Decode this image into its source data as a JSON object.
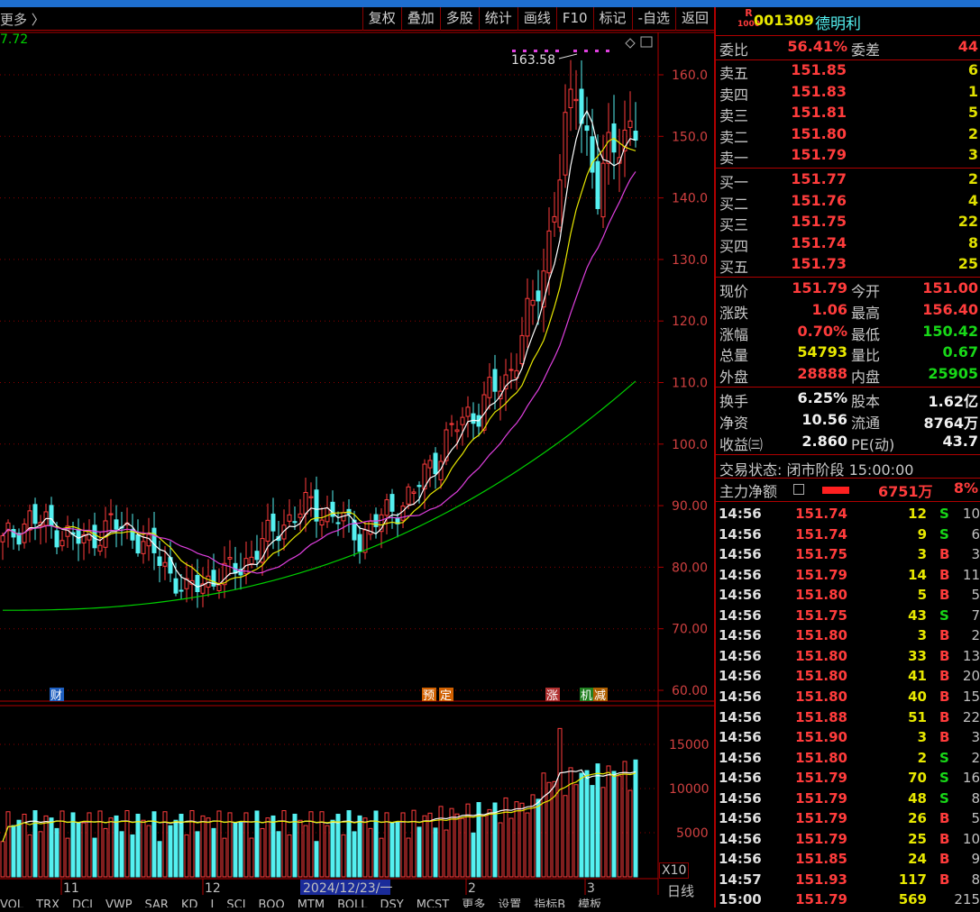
{
  "toolbar": {
    "crumb": "更多 〉",
    "buttons": [
      "复权",
      "叠加",
      "多股",
      "统计",
      "画线",
      "F10",
      "标记",
      "-自选",
      "返回"
    ]
  },
  "chart": {
    "price_label": "7.72",
    "price_ticks": [
      "160.0",
      "150.0",
      "140.0",
      "130.0",
      "120.0",
      "110.0",
      "100.0",
      "90.00",
      "80.00",
      "70.00",
      "60.00"
    ],
    "vol_ticks": [
      "15000",
      "10000",
      "5000"
    ],
    "x_labels": [
      "11",
      "12",
      "2024/12/23/一",
      "2",
      "3"
    ],
    "high_marker": "163.58",
    "event_markers": [
      "财",
      "预",
      "定",
      "涨",
      "机",
      "减"
    ],
    "x10": "X10",
    "period": "日线",
    "bottom_tabs": [
      "VOL",
      "TRX",
      "DCI",
      "VWP",
      "SAR",
      "KD",
      "J",
      "SCI",
      "BOO",
      "MTM",
      "BOLL",
      "DSY",
      "MCST",
      "更多",
      "设置",
      "指标B",
      "模板"
    ],
    "colors": {
      "up": "#ff3c3c",
      "down": "#54f0f0",
      "ma5": "#ffffff",
      "ma10": "#e8e800",
      "ma20": "#e040e0",
      "ma60": "#00d000"
    }
  },
  "chart_data": {
    "type": "candlestick",
    "y_range": [
      60,
      165
    ],
    "volume_range": [
      0,
      17000
    ],
    "candles_note": "approximate daily OHLC",
    "recent_high": 163.58
  },
  "panel": {
    "logo": "R",
    "logo_sub": "1000",
    "code": "001309",
    "name": "德明利",
    "weibi_label": "委比",
    "weibi": "56.41%",
    "weicha_label": "委差",
    "weicha": "44",
    "asks": [
      {
        "label": "卖五",
        "price": "151.85",
        "vol": "6"
      },
      {
        "label": "卖四",
        "price": "151.83",
        "vol": "1"
      },
      {
        "label": "卖三",
        "price": "151.81",
        "vol": "5"
      },
      {
        "label": "卖二",
        "price": "151.80",
        "vol": "2"
      },
      {
        "label": "卖一",
        "price": "151.79",
        "vol": "3"
      }
    ],
    "bids": [
      {
        "label": "买一",
        "price": "151.77",
        "vol": "2"
      },
      {
        "label": "买二",
        "price": "151.76",
        "vol": "4"
      },
      {
        "label": "买三",
        "price": "151.75",
        "vol": "22"
      },
      {
        "label": "买四",
        "price": "151.74",
        "vol": "8"
      },
      {
        "label": "买五",
        "price": "151.73",
        "vol": "25"
      }
    ],
    "stats": [
      {
        "l1": "现价",
        "v1": "151.79",
        "c1": "red",
        "l2": "今开",
        "v2": "151.00",
        "c2": "red"
      },
      {
        "l1": "涨跌",
        "v1": "1.06",
        "c1": "red",
        "l2": "最高",
        "v2": "156.40",
        "c2": "red"
      },
      {
        "l1": "涨幅",
        "v1": "0.70%",
        "c1": "red",
        "l2": "最低",
        "v2": "150.42",
        "c2": "green"
      },
      {
        "l1": "总量",
        "v1": "54793",
        "c1": "yellow",
        "l2": "量比",
        "v2": "0.67",
        "c2": "green"
      },
      {
        "l1": "外盘",
        "v1": "28888",
        "c1": "red",
        "l2": "内盘",
        "v2": "25905",
        "c2": "green"
      }
    ],
    "stats2": [
      {
        "l1": "换手",
        "v1": "6.25%",
        "l2": "股本",
        "v2": "1.62亿"
      },
      {
        "l1": "净资",
        "v1": "10.56",
        "l2": "流通",
        "v2": "8764万"
      },
      {
        "l1": "收益㈢",
        "v1": "2.860",
        "l2": "PE(动)",
        "v2": "43.7"
      }
    ],
    "trade_status": "交易状态: 闭市阶段 15:00:00",
    "main_flow_label": "主力净额",
    "main_flow_value": "6751万",
    "main_flow_pct": "8%",
    "ticks": [
      {
        "t": "14:56",
        "p": "151.74",
        "v": "12",
        "bs": "S",
        "n": "10"
      },
      {
        "t": "14:56",
        "p": "151.74",
        "v": "9",
        "bs": "S",
        "n": "6"
      },
      {
        "t": "14:56",
        "p": "151.75",
        "v": "3",
        "bs": "B",
        "n": "3"
      },
      {
        "t": "14:56",
        "p": "151.79",
        "v": "14",
        "bs": "B",
        "n": "11"
      },
      {
        "t": "14:56",
        "p": "151.80",
        "v": "5",
        "bs": "B",
        "n": "5"
      },
      {
        "t": "14:56",
        "p": "151.75",
        "v": "43",
        "bs": "S",
        "n": "7"
      },
      {
        "t": "14:56",
        "p": "151.80",
        "v": "3",
        "bs": "B",
        "n": "2"
      },
      {
        "t": "14:56",
        "p": "151.80",
        "v": "33",
        "bs": "B",
        "n": "13"
      },
      {
        "t": "14:56",
        "p": "151.80",
        "v": "41",
        "bs": "B",
        "n": "20"
      },
      {
        "t": "14:56",
        "p": "151.80",
        "v": "40",
        "bs": "B",
        "n": "15"
      },
      {
        "t": "14:56",
        "p": "151.88",
        "v": "51",
        "bs": "B",
        "n": "22"
      },
      {
        "t": "14:56",
        "p": "151.90",
        "v": "3",
        "bs": "B",
        "n": "3"
      },
      {
        "t": "14:56",
        "p": "151.80",
        "v": "2",
        "bs": "S",
        "n": "2"
      },
      {
        "t": "14:56",
        "p": "151.79",
        "v": "70",
        "bs": "S",
        "n": "16"
      },
      {
        "t": "14:56",
        "p": "151.79",
        "v": "48",
        "bs": "S",
        "n": "8"
      },
      {
        "t": "14:56",
        "p": "151.79",
        "v": "26",
        "bs": "B",
        "n": "5"
      },
      {
        "t": "14:56",
        "p": "151.79",
        "v": "25",
        "bs": "B",
        "n": "10"
      },
      {
        "t": "14:56",
        "p": "151.85",
        "v": "24",
        "bs": "B",
        "n": "9"
      },
      {
        "t": "14:57",
        "p": "151.93",
        "v": "117",
        "bs": "B",
        "n": "8"
      },
      {
        "t": "15:00",
        "p": "151.79",
        "v": "569",
        "bs": "",
        "n": "215"
      }
    ]
  }
}
